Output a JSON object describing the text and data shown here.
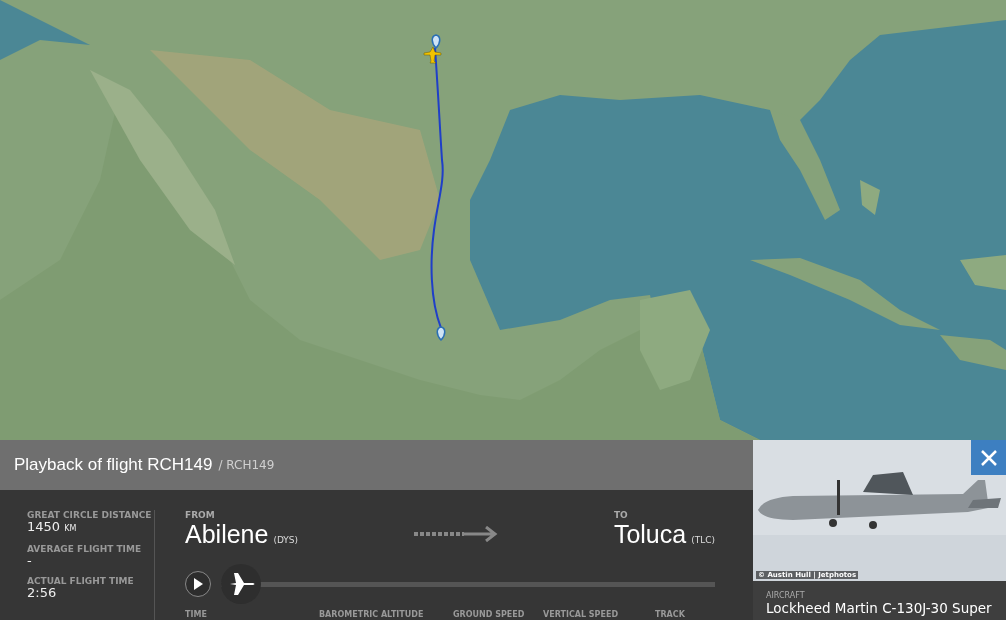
{
  "panel": {
    "title": "Playback of flight RCH149",
    "subtitle": "/ RCH149",
    "stats": [
      {
        "label": "GREAT CIRCLE DISTANCE",
        "value": "1450",
        "unit": "KM"
      },
      {
        "label": "AVERAGE FLIGHT TIME",
        "value": "-"
      },
      {
        "label": "ACTUAL FLIGHT TIME",
        "value": "2:56"
      }
    ],
    "from": {
      "label": "FROM",
      "city": "Abilene",
      "code": "(DYS)"
    },
    "to": {
      "label": "TO",
      "city": "Toluca",
      "code": "(TLC)"
    },
    "playback": {
      "level": 0
    },
    "columns": [
      "TIME",
      "BAROMETRIC ALTITUDE",
      "GROUND SPEED",
      "VERTICAL SPEED",
      "TRACK"
    ]
  },
  "aircraft": {
    "photo": {
      "credit": "© Austin Hull | Jetphotos"
    },
    "label": "AIRCRAFT",
    "name": "Lockheed Martin C-130J-30 Super"
  }
}
